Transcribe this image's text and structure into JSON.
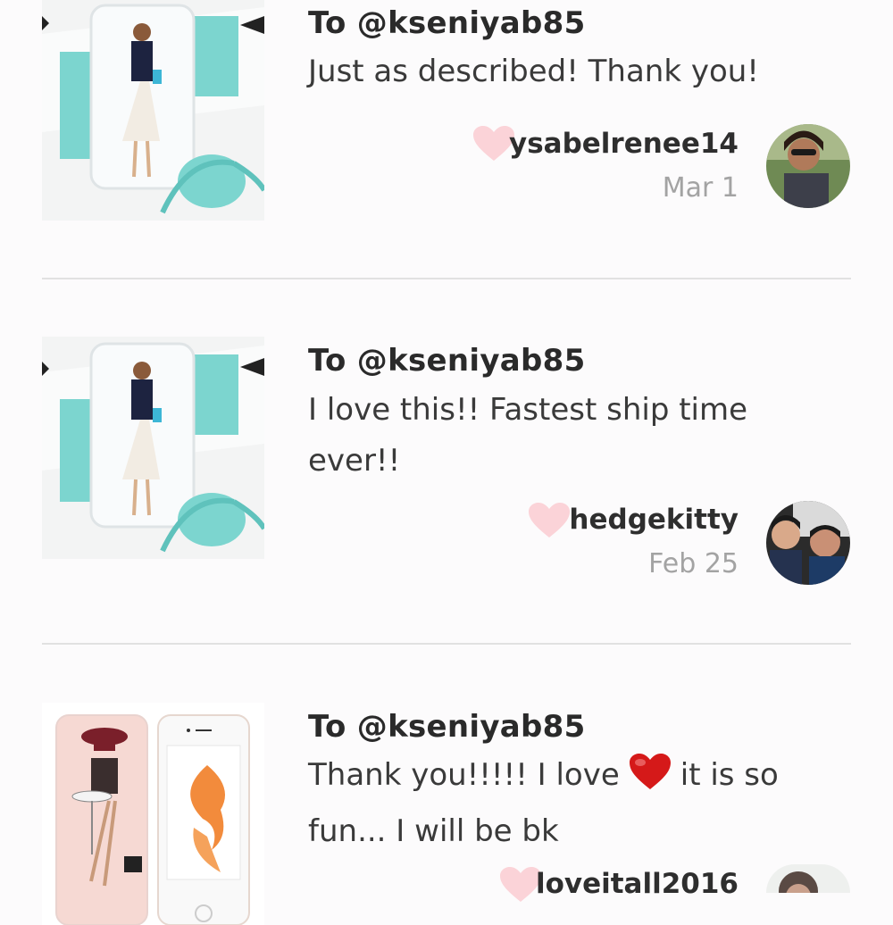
{
  "reviews": [
    {
      "to": "To @kseniyab85",
      "comment": "Just as described! Thank you!",
      "username": "ysabelrenee14",
      "date": "Mar 1",
      "thumb_icon": "phone-case-fashion-illustration",
      "avatar_icon": "user-avatar"
    },
    {
      "to": "To @kseniyab85",
      "comment": "I love this!! Fastest ship time ever!!",
      "username": "hedgekitty",
      "date": "Feb 25",
      "thumb_icon": "phone-case-fashion-illustration",
      "avatar_icon": "user-avatar"
    },
    {
      "to": "To @kseniyab85",
      "comment_before": "Thank you!!!!! I love",
      "comment_after": "it is so fun... I will be bk",
      "comment_emoji": "red-heart-emoji",
      "username": "loveitall2016",
      "thumb_icon": "phone-cases-illustration",
      "avatar_icon": "user-avatar"
    }
  ],
  "colors": {
    "like_heart": "#fbd3d8",
    "emoji_heart": "#d51919",
    "accent_tiffany": "#7cd5cf"
  }
}
